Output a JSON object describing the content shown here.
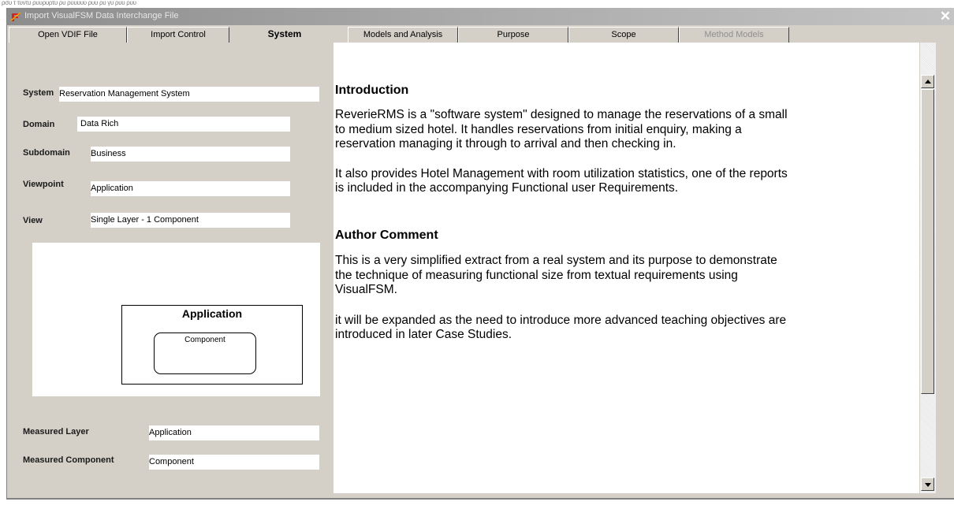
{
  "background_scribble": "ρσυ τ τυντυ ρυυρυρτυ ρυ  ρυυυυυ ρυυ ρυ   γυ ρυυ  ρυυ",
  "window": {
    "title": "Import VisualFSM Data Interchange File",
    "close_glyph": "✕"
  },
  "tabs": [
    {
      "label": "Open VDIF File",
      "state": "normal"
    },
    {
      "label": "Import Control",
      "state": "normal"
    },
    {
      "label": "System",
      "state": "active"
    },
    {
      "label": "Models and Analysis",
      "state": "normal"
    },
    {
      "label": "Purpose",
      "state": "normal"
    },
    {
      "label": "Scope",
      "state": "normal"
    },
    {
      "label": "Method Models",
      "state": "disabled"
    }
  ],
  "system": {
    "system_label": "System",
    "system_value": "Reservation Management System",
    "domain_label": "Domain",
    "domain_value": "Data Rich",
    "subdomain_label": "Subdomain",
    "subdomain_value": "Business",
    "viewpoint_label": "Viewpoint",
    "viewpoint_value": "Application",
    "view_label": "View",
    "view_value": "Single  Layer - 1 Component",
    "measured_layer_label": "Measured Layer",
    "measured_layer_value": "Application",
    "measured_component_label": "Measured Component",
    "measured_component_value": "Component"
  },
  "diagram": {
    "layer_title": "Application",
    "component_title": "Component"
  },
  "document": {
    "introduction_heading": "Introduction",
    "intro_p1_line1": "ReverieRMS is a \"software system\" designed to manage the reservations of a small",
    "intro_p1_line2": "to medium sized hotel. It handles reservations from initial enquiry, making a",
    "intro_p1_line3": "reservation  managing it through to arrival and then checking in.",
    "intro_p2_line1": "It also provides Hotel Management with room utilization statistics, one of the reports",
    "intro_p2_line2": "is included in the accompanying Functional user Requirements.",
    "author_heading": "Author Comment",
    "author_p1_line1": "This is a very simplified extract from a real system and its purpose  to demonstrate",
    "author_p1_line2": "the technique of measuring functional size from textual requirements using",
    "author_p1_line3": "VisualFSM.",
    "author_p2_line1": "it will be expanded as the need to introduce more advanced teaching objectives are",
    "author_p2_line2": "introduced in later Case Studies."
  },
  "colors": {
    "titlebar_start": "#8d8d8d",
    "titlebar_end": "#c4c4c4",
    "dialog_face": "#d4d0c8",
    "icon_red": "#d42020"
  }
}
